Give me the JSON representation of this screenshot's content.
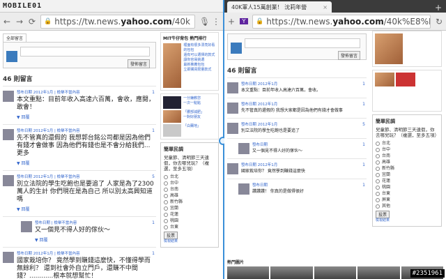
{
  "left": {
    "logo": "MOBILE01",
    "url_prefix": "https://tw.news.",
    "url_domain": "yahoo.com",
    "url_suffix": "/40k",
    "section_tab": "全部留言",
    "post_button": "發佈留言",
    "count_label": "46 則留言",
    "comments": [
      {
        "meta": "發布日期 2012年1月 | 檢舉不當內容",
        "text": "本文重點：目前年收入高達六百萬，會收，應閱，敢會！",
        "reply": "▼ 回覆",
        "likes": "1"
      },
      {
        "meta": "發布日期 2012年1月 | 檢舉不當內容",
        "text": "先不管真的還假的 我想郭台銘公司都是因為他們有錢才會做事 因為他們有錢也是不會分給我們...更多",
        "reply": "▼ 回覆",
        "likes": "1"
      },
      {
        "meta": "發布日期 2012年1月 | 檢舉不當內容",
        "text": "別立法院的學生吃飽也是要追了 人家是為了2300萬人的生計 你們現在是為自己 所以別太高興知道嗎",
        "reply": "▼ 回覆",
        "likes": "5"
      },
      {
        "meta": "發布日期 | 檢舉不當內容",
        "text": "又一個見不得人好的傢伙～",
        "reply": "▼ 回覆",
        "likes": "1"
      },
      {
        "meta": "發布日期 2012年1月 | 檢舉不當內容",
        "text": "國家栽培你？ 竟然學到賺錢這麼快，不懂得學而無餘利？ 還到社會外自立門戶，還賺不中間 錢？............根本就想幫忙！",
        "reply": "",
        "likes": "1"
      }
    ],
    "ad_title": "MIT牛仔背包 熱門排行",
    "ad_lines": [
      "裡面有很多漂亮好看的包包",
      "還有可以選擇的款式",
      "讓你容易挑選",
      "最新推薦包包",
      "立即購買限量款式"
    ],
    "side_links": [
      "一分鐘教您",
      "一次一點點",
      "「腰部減肥」",
      "一對好朋友",
      "「白蘭地」"
    ],
    "poll": {
      "title": "簡單民調",
      "question": "兒童節、清明節三天連假，你去哪兒玩？（複選，至多五項）",
      "options": [
        "台北",
        "台中",
        "台南",
        "高雄",
        "新竹縣",
        "宜蘭",
        "花蓮",
        "桃園",
        "台東",
        "屏東",
        "其他"
      ],
      "vote": "投票",
      "result": "檢視結果"
    }
  },
  "right": {
    "tab_title": "40K軍人15萬創業！ 沈莉年營",
    "url_prefix": "https://tw.news.",
    "url_domain": "yahoo.com",
    "url_suffix": "/40k%E8%BB%8D%...",
    "post_button": "發佈留言",
    "count_label": "46 則留言",
    "comments": [
      {
        "meta": "發布日期 2012年1月",
        "text": "本文重點：目前年收入高達六百萬，會收。",
        "likes": "1"
      },
      {
        "meta": "發布日期 2012年1月",
        "text": "先不管真的還假的 我想大家都是因為他們有錢才會做事",
        "likes": "1"
      },
      {
        "meta": "發布日期 2012年1月",
        "text": "別立法院的學生吃飽也是要追了",
        "likes": "5"
      },
      {
        "meta": "發布日期",
        "text": "又一個見不得人好的傢伙～",
        "likes": "1"
      },
      {
        "meta": "發布日期 2012年1月",
        "text": "國家栽培你？ 竟然學到賺錢這麼快",
        "likes": "1"
      },
      {
        "meta": "發布日期",
        "text": "讚讚讚！ 你真的是做得很好",
        "likes": "1"
      }
    ],
    "poll": {
      "title": "簡單民調",
      "question": "兒童節、清明節三天連假，你去哪兒玩？（複選，至多五項）",
      "options": [
        "台北",
        "台中",
        "台南",
        "高雄",
        "新竹縣",
        "宜蘭",
        "花蓮",
        "桃園",
        "台東",
        "屏東",
        "其他"
      ],
      "vote": "投票",
      "result": "檢視結果"
    },
    "bottom_label": "熱門圖片"
  },
  "watermark": "#2351961"
}
